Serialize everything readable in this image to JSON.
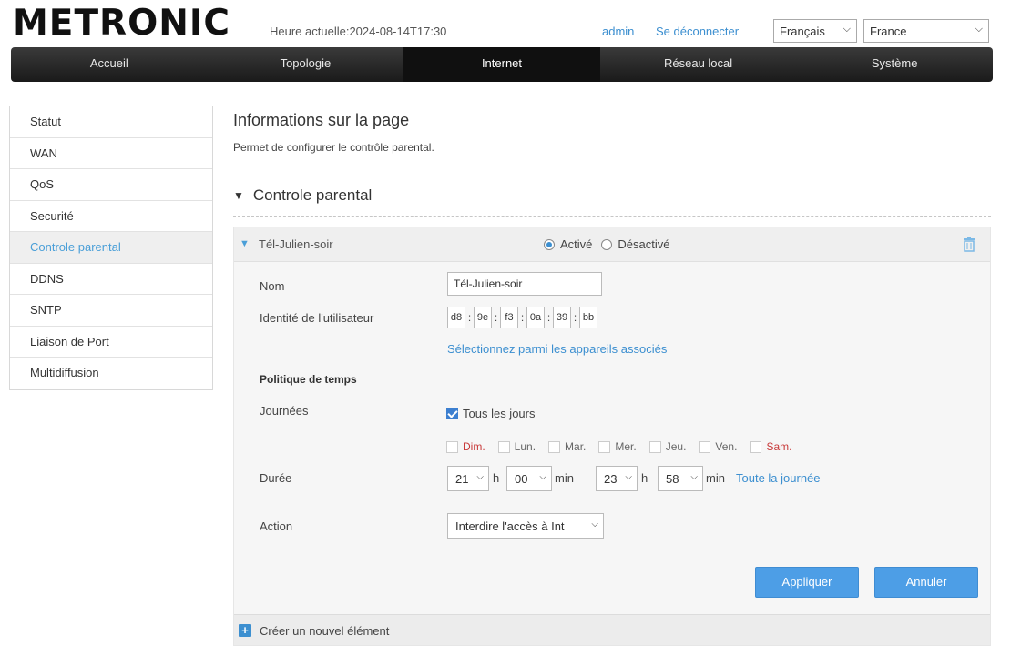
{
  "header": {
    "logo": "METRONIC",
    "current_time": "Heure actuelle:2024-08-14T17:30",
    "user": "admin",
    "logout": "Se déconnecter",
    "language": "Français",
    "country": "France"
  },
  "nav": {
    "items": [
      "Accueil",
      "Topologie",
      "Internet",
      "Réseau local",
      "Système"
    ],
    "active": "Internet"
  },
  "sidebar": {
    "items": [
      "Statut",
      "WAN",
      "QoS",
      "Securité",
      "Controle parental",
      "DDNS",
      "SNTP",
      "Liaison de Port",
      "Multidiffusion"
    ],
    "active": "Controle parental"
  },
  "main": {
    "title": "Informations sur la page",
    "description": "Permet de configurer le contrôle parental.",
    "section_title": "Controle parental",
    "rule": {
      "name": "Tél-Julien-soir",
      "status_active": "Activé",
      "status_inactive": "Désactivé",
      "status": "active",
      "name_label": "Nom",
      "name_value": "Tél-Julien-soir",
      "user_id_label": "Identité de l'utilisateur",
      "mac": [
        "d8",
        "9e",
        "f3",
        "0a",
        "39",
        "bb"
      ],
      "select_device_link": "Sélectionnez parmi les appareils associés",
      "time_policy_heading": "Politique de temps",
      "days_label": "Journées",
      "all_days_label": "Tous les jours",
      "all_days_checked": true,
      "days": [
        {
          "label": "Dim.",
          "weekend": true
        },
        {
          "label": "Lun.",
          "weekend": false
        },
        {
          "label": "Mar.",
          "weekend": false
        },
        {
          "label": "Mer.",
          "weekend": false
        },
        {
          "label": "Jeu.",
          "weekend": false
        },
        {
          "label": "Ven.",
          "weekend": false
        },
        {
          "label": "Sam.",
          "weekend": true
        }
      ],
      "duration_label": "Durée",
      "start_hour": "21",
      "start_min": "00",
      "end_hour": "23",
      "end_min": "58",
      "unit_h": "h",
      "unit_min": "min",
      "dash": "–",
      "all_day_link": "Toute la journée",
      "action_label": "Action",
      "action_value": "Interdire l'accès à Int",
      "apply": "Appliquer",
      "cancel": "Annuler"
    },
    "create_new": "Créer un nouvel élément"
  },
  "colors": {
    "accent": "#3c8fd0",
    "button": "#4d9ee6",
    "weekend_day": "#c83a3a",
    "nav_bg": "#2a2a2a"
  }
}
